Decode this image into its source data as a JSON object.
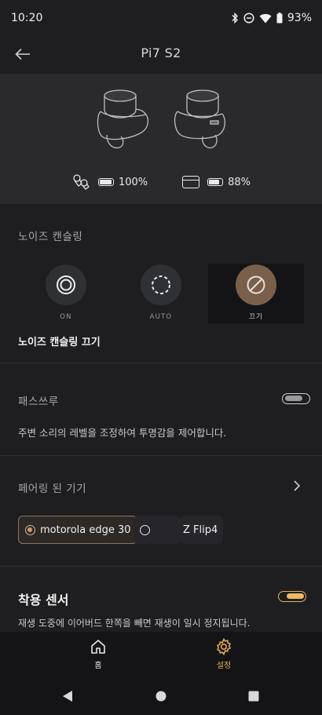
{
  "status_bar": {
    "time": "10:20",
    "battery": "93%"
  },
  "header": {
    "title": "Pi7 S2"
  },
  "battery": {
    "buds_level": "100%",
    "buds_fill": 1.0,
    "case_level": "88%",
    "case_fill": 0.88
  },
  "noise_cancelling": {
    "section_label": "노이즈 캔슬링",
    "options": [
      {
        "label": "ON",
        "icon": "concentric-circle-icon",
        "selected": false
      },
      {
        "label": "AUTO",
        "icon": "dashed-circle-icon",
        "selected": false
      },
      {
        "label": "끄기",
        "icon": "slash-circle-icon",
        "selected": true
      }
    ],
    "status_text": "노이즈 캔슬링 끄기"
  },
  "passthrough": {
    "label": "패스쓰루",
    "enabled": false,
    "description": "주변 소리의 레벨을 조정하여 투명감을 제어합니다."
  },
  "paired_devices": {
    "label": "페어링 된 기기",
    "devices": [
      {
        "name": "motorola edge 30",
        "selected": true
      },
      {
        "name": "",
        "selected": false
      },
      {
        "name": "Z Flip4",
        "selected": false
      }
    ]
  },
  "wear_sensor": {
    "title": "착용 센서",
    "enabled": true,
    "description": "재생 도중에 이어버드 한쪽을 빼면 재생이 일시 정지됩니다."
  },
  "bottom_nav": {
    "home_label": "홈",
    "settings_label": "설정",
    "active": "settings"
  },
  "colors": {
    "accent": "#e4a857",
    "background": "#1e1e20",
    "hero_bg": "#2a2a2d",
    "selected_nc": "#7a5f4b"
  }
}
